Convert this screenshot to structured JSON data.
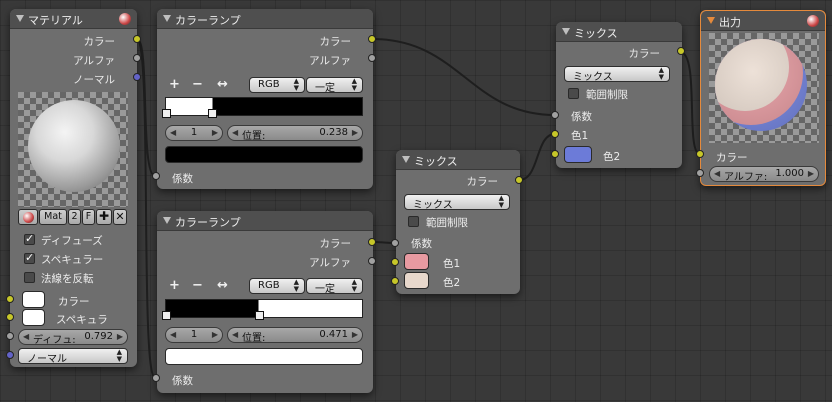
{
  "colors": {
    "socket_color": "#c7c729",
    "socket_value": "#a1a1a1",
    "socket_vector": "#6363c7",
    "link": "#1b1b1b",
    "output_border": "#e58a3c",
    "mix_color2": "#6c7bd8",
    "mix2_color1": "#e89aa1",
    "mix2_color2": "#e8d8cc"
  },
  "material_node": {
    "title": "マテリアル",
    "outputs": [
      "カラー",
      "アルファ",
      "ノーマル"
    ],
    "mat_name": "Mat",
    "mat_users": "2",
    "fake_user": "F",
    "diffuse_label": "ディフューズ",
    "specular_label": "スペキュラー",
    "invert_normal_label": "法線を反転",
    "color_label": "カラー",
    "spec_label": "スペキュラ",
    "diffuse_intensity_label": "ディフュ:",
    "diffuse_intensity_value": "0.792",
    "normal_label": "ノーマル",
    "diffuse_checked": true,
    "specular_checked": true,
    "invert_checked": false
  },
  "ramp1": {
    "title": "カラーランプ",
    "out_color": "カラー",
    "out_alpha": "アルファ",
    "mode": "RGB",
    "interp": "一定",
    "index": "1",
    "position_label": "位置:",
    "position_value": "0.238",
    "position_fraction": 0.238,
    "in_fac": "係数",
    "stop_color": "#000000"
  },
  "ramp2": {
    "title": "カラーランプ",
    "out_color": "カラー",
    "out_alpha": "アルファ",
    "mode": "RGB",
    "interp": "一定",
    "index": "1",
    "position_label": "位置:",
    "position_value": "0.471",
    "position_fraction": 0.471,
    "in_fac": "係数",
    "stop_color": "#ffffff"
  },
  "mix_top": {
    "title": "ミックス",
    "out_color": "カラー",
    "mode": "ミックス",
    "clamp_label": "範囲制限",
    "in_fac": "係数",
    "in_color1": "色1",
    "in_color2": "色2"
  },
  "mix_mid": {
    "title": "ミックス",
    "out_color": "カラー",
    "mode": "ミックス",
    "clamp_label": "範囲制限",
    "in_fac": "係数",
    "in_color1": "色1",
    "in_color2": "色2"
  },
  "output": {
    "title": "出力",
    "in_color": "カラー",
    "alpha_label": "アルファ:",
    "alpha_value": "1.000"
  },
  "ramp_tools": {
    "add": "+",
    "remove": "−",
    "flip": "↔"
  }
}
